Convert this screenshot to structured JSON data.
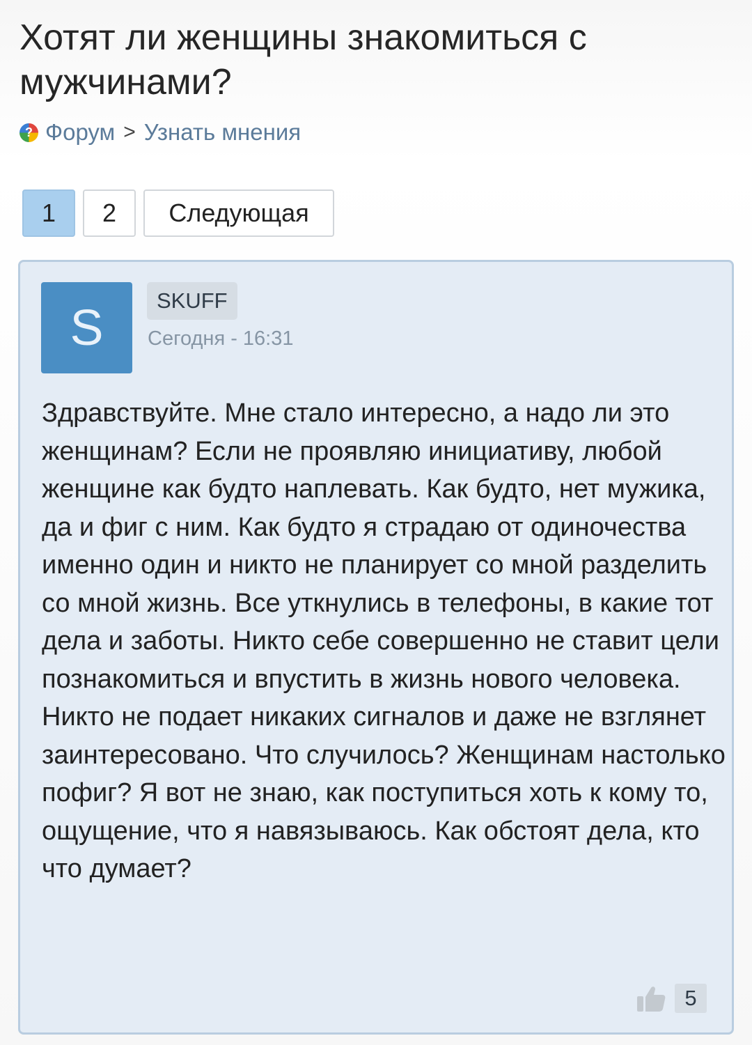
{
  "topic": {
    "title": "Хотят ли женщины знакомиться с мужчинами?"
  },
  "breadcrumb": {
    "icon": "question-globe-icon",
    "icon_glyph": "?",
    "forum": "Форум",
    "separator": ">",
    "section": "Узнать мнения"
  },
  "pagination": {
    "pages": [
      "1",
      "2"
    ],
    "current_page": "1",
    "next_label": "Следующая"
  },
  "post": {
    "avatar_letter": "S",
    "author": "SKUFF",
    "time": "Сегодня - 16:31",
    "text": "Здравствуйте. Мне стало интересно, а надо ли это женщинам? Если не проявляю инициативу, любой женщине как будто наплевать. Как будто, нет мужика, да и фиг с ним. Как будто я страдаю от одиночества именно один и никто не планирует со мной разделить со мной жизнь. Все уткнулись в телефоны, в какие тот дела и заботы. Никто себе совершенно не ставит цели познакомиться и впустить в жизнь нового человека. Никто не подает никаких сигналов и даже не взглянет заинтересовано. Что случилось? Женщинам настолько пофиг? Я вот не знаю, как поступиться хоть к кому то, ощущение, что я навязываюсь. Как обстоят дела, кто что думает?",
    "likes": "5",
    "like_icon": "thumbs-up-icon"
  },
  "colors": {
    "post_background": "#e4ecf5",
    "post_border": "#b9cde0",
    "avatar": "#4a8ec4",
    "active_page": "#a9cfee",
    "link": "#5b7b9a"
  }
}
